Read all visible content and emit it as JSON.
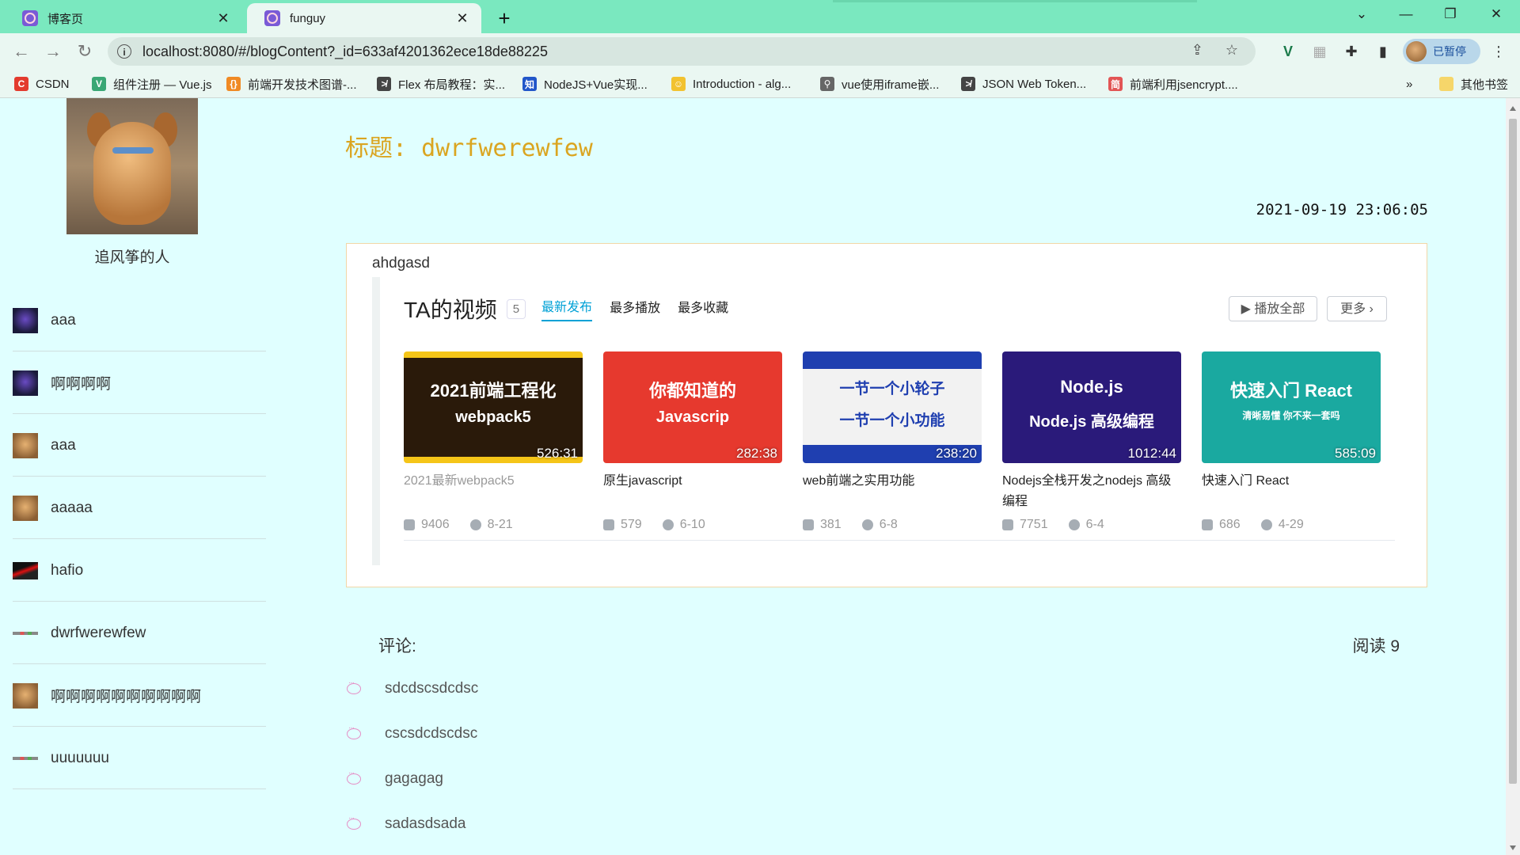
{
  "browser": {
    "tabs": [
      {
        "title": "博客页",
        "active": false
      },
      {
        "title": "funguy",
        "active": true
      }
    ],
    "new_tab_icon": "plus-icon",
    "url": "localhost:8080/#/blogContent?_id=633af4201362ece18de88225",
    "profile_status": "已暂停",
    "bookmarks": [
      {
        "label": "CSDN",
        "icon_color": "#e33b2e",
        "icon_text": "C"
      },
      {
        "label": "组件注册 — Vue.js",
        "icon_color": "#3aa775",
        "icon_text": "V"
      },
      {
        "label": "前端开发技术图谱-...",
        "icon_color": "#f08a24",
        "icon_text": "{}"
      },
      {
        "label": "Flex 布局教程：实...",
        "icon_color": "#444444",
        "icon_text": "≯"
      },
      {
        "label": "NodeJS+Vue实现...",
        "icon_color": "#2156c9",
        "icon_text": "知"
      },
      {
        "label": "Introduction - alg...",
        "icon_color": "#f2c230",
        "icon_text": "☺"
      },
      {
        "label": "vue使用iframe嵌...",
        "icon_color": "#666666",
        "icon_text": "⚲"
      },
      {
        "label": "JSON Web Token...",
        "icon_color": "#444444",
        "icon_text": "≯"
      },
      {
        "label": "前端利用jsencrypt....",
        "icon_color": "#e25555",
        "icon_text": "简"
      }
    ],
    "other_bookmarks": "其他书签"
  },
  "sidebar": {
    "username": "追风筝的人",
    "items": [
      {
        "label": "aaa",
        "avatar": "dark"
      },
      {
        "label": "啊啊啊啊",
        "avatar": "dark"
      },
      {
        "label": "aaa",
        "avatar": "dog"
      },
      {
        "label": "aaaaa",
        "avatar": "dog"
      },
      {
        "label": "hafio",
        "avatar": "red"
      },
      {
        "label": "dwrfwerewfew",
        "avatar": "line"
      },
      {
        "label": "啊啊啊啊啊啊啊啊啊啊",
        "avatar": "dog"
      },
      {
        "label": "uuuuuuu",
        "avatar": "line"
      }
    ]
  },
  "blog": {
    "title": "标题: dwrfwerewfew",
    "date": "2021-09-19 23:06:05",
    "content_text": "ahdgasd",
    "embed": {
      "heading": "TA的视频",
      "count": "5",
      "tabs": [
        "最新发布",
        "最多播放",
        "最多收藏"
      ],
      "active_tab": "最新发布",
      "play_all": "播放全部",
      "more": "更多",
      "videos": [
        {
          "thumb_text": "2021前端工程化",
          "thumb_text2": "webpack5",
          "duration": "526:31",
          "title": "2021最新webpack5",
          "plays": "9406",
          "date": "8-21",
          "thumb_bg": "#f5c518"
        },
        {
          "thumb_text": "你都知道的",
          "thumb_text2": "Javascrip",
          "duration": "282:38",
          "title": "原生javascript",
          "plays": "579",
          "date": "6-10",
          "thumb_bg": "#e6392e"
        },
        {
          "thumb_text": "一节一个小轮子",
          "thumb_text2": "一节一个小功能",
          "duration": "238:20",
          "title": "web前端之实用功能",
          "plays": "381",
          "date": "6-8",
          "thumb_bg": "#1f3fb0"
        },
        {
          "thumb_text": "Node.js",
          "thumb_text2": "Node.js 高级编程",
          "duration": "1012:44",
          "title": "Nodejs全栈开发之nodejs 高级编程",
          "plays": "7751",
          "date": "6-4",
          "thumb_bg": "#2a1a7a"
        },
        {
          "thumb_text": "快速入门 React",
          "thumb_text2": "清晰易懂 你不来一套吗",
          "duration": "585:09",
          "title": "快速入门 React",
          "plays": "686",
          "date": "4-29",
          "thumb_bg": "#1aa9a0"
        }
      ]
    },
    "comments_label": "评论:",
    "read_count": "阅读 9",
    "comments": [
      "sdcdscsdcdsc",
      "cscsdcdscdsc",
      "gagagag",
      "sadasdsada"
    ]
  }
}
